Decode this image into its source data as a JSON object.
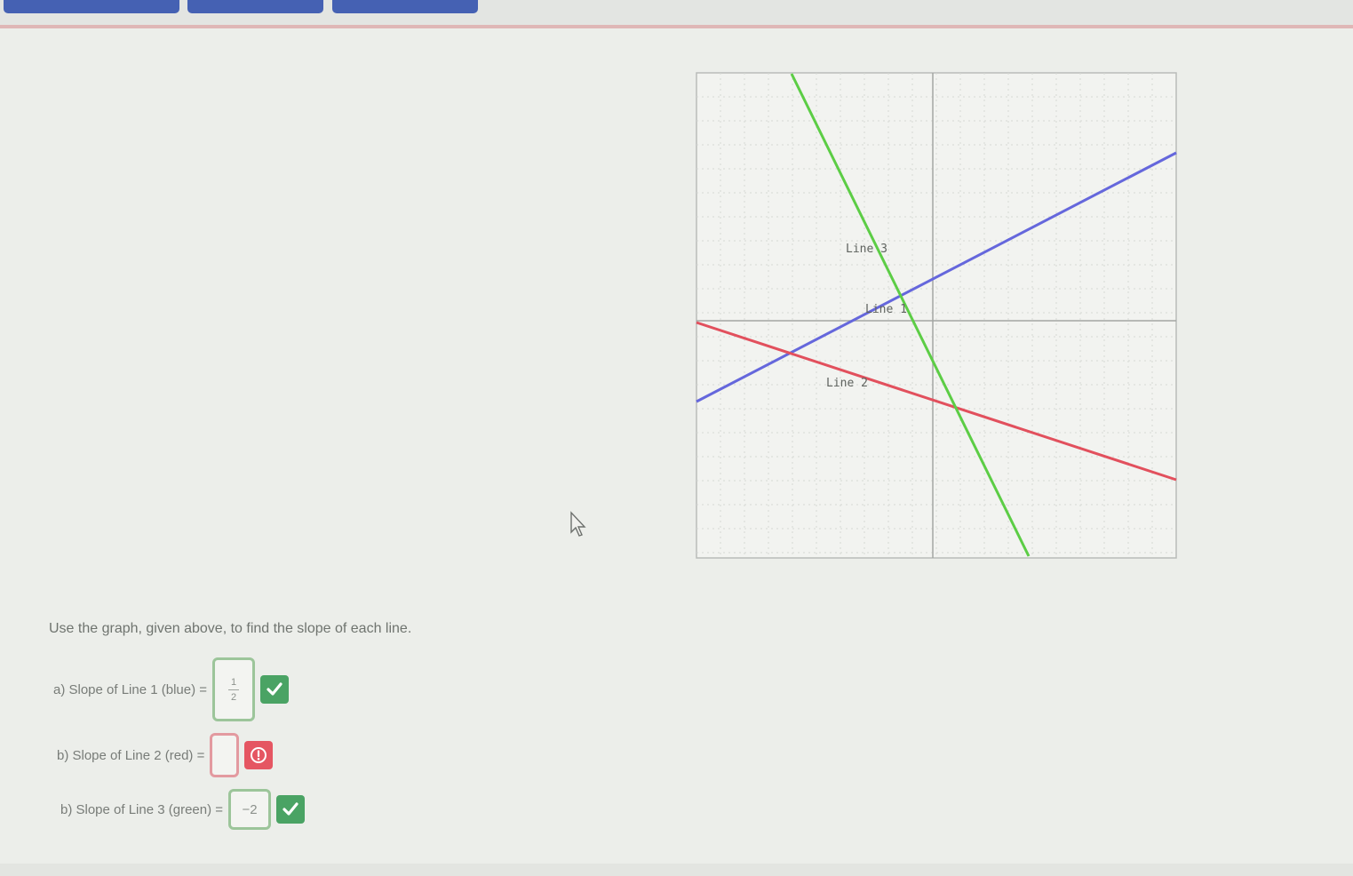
{
  "tabs": [
    "",
    "",
    ""
  ],
  "graph": {
    "line_labels": {
      "line3": "Line 3",
      "line1": "Line 1",
      "line2": "Line 2"
    },
    "colors": {
      "line1": "#6567dc",
      "line2": "#e2505d",
      "line3": "#5ccd45",
      "grid": "#c9ccc8",
      "axis": "#a3a6a3"
    }
  },
  "question": {
    "prompt": "Use the graph, given above, to find the slope of each line.",
    "items": [
      {
        "label": "a) Slope of Line 1 (blue) =",
        "answer_num": "1",
        "answer_den": "2",
        "status": "correct",
        "status_icon": "checkmark-icon"
      },
      {
        "label": "b) Slope of Line 2 (red) =",
        "answer": "",
        "status": "error",
        "status_icon": "alert-icon"
      },
      {
        "label": "b) Slope of Line 3 (green) =",
        "answer": "−2",
        "status": "correct",
        "status_icon": "checkmark-icon"
      }
    ]
  }
}
